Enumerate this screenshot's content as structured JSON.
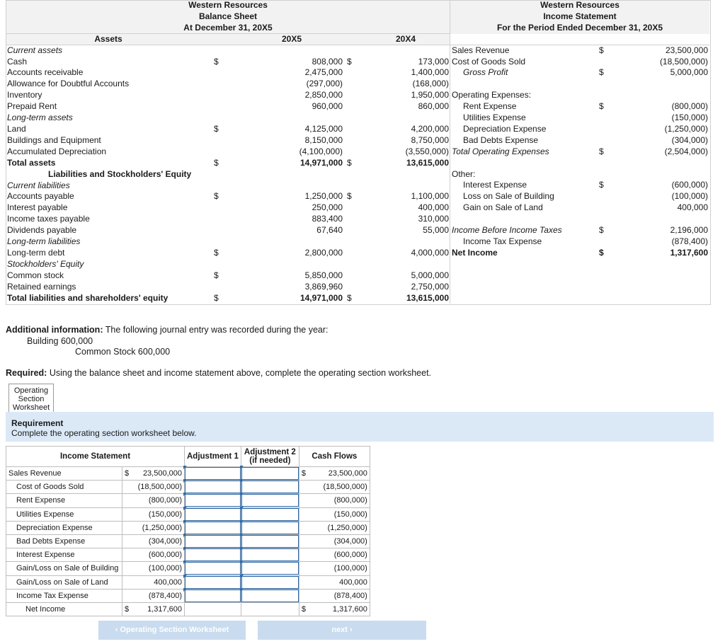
{
  "balance_sheet": {
    "company": "Western Resources",
    "title": "Balance Sheet",
    "date": "At December 31, 20X5",
    "col_assets": "Assets",
    "col_y1": "20X5",
    "col_y2": "20X4",
    "rows": [
      {
        "label": "Current assets",
        "style": "it",
        "d1": "",
        "v1": "",
        "d2": "",
        "v2": ""
      },
      {
        "label": "Cash",
        "style": "",
        "d1": "$",
        "v1": "808,000",
        "d2": "$",
        "v2": "173,000"
      },
      {
        "label": "Accounts receivable",
        "style": "",
        "d1": "",
        "v1": "2,475,000",
        "d2": "",
        "v2": "1,400,000"
      },
      {
        "label": "Allowance for Doubtful Accounts",
        "style": "",
        "d1": "",
        "v1": "(297,000)",
        "d2": "",
        "v2": "(168,000)"
      },
      {
        "label": "Inventory",
        "style": "",
        "d1": "",
        "v1": "2,850,000",
        "d2": "",
        "v2": "1,950,000"
      },
      {
        "label": "Prepaid Rent",
        "style": "",
        "d1": "",
        "v1": "960,000",
        "d2": "",
        "v2": "860,000"
      },
      {
        "label": "Long-term assets",
        "style": "it",
        "d1": "",
        "v1": "",
        "d2": "",
        "v2": ""
      },
      {
        "label": "Land",
        "style": "",
        "d1": "$",
        "v1": "4,125,000",
        "d2": "",
        "v2": "4,200,000"
      },
      {
        "label": "Buildings and Equipment",
        "style": "",
        "d1": "",
        "v1": "8,150,000",
        "d2": "",
        "v2": "8,750,000"
      },
      {
        "label": "Accumulated Depreciation",
        "style": "",
        "d1": "",
        "v1": "(4,100,000)",
        "d2": "",
        "v2": "(3,550,000)"
      },
      {
        "label": "Total assets",
        "style": "b",
        "d1": "$",
        "v1": "14,971,000",
        "d2": "$",
        "v2": "13,615,000"
      },
      {
        "label": "Liabilities and Stockholders' Equity",
        "style": "bc",
        "d1": "",
        "v1": "",
        "d2": "",
        "v2": ""
      },
      {
        "label": "Current liabilities",
        "style": "it",
        "d1": "",
        "v1": "",
        "d2": "",
        "v2": ""
      },
      {
        "label": "Accounts payable",
        "style": "",
        "d1": "$",
        "v1": "1,250,000",
        "d2": "$",
        "v2": "1,100,000"
      },
      {
        "label": "Interest payable",
        "style": "",
        "d1": "",
        "v1": "250,000",
        "d2": "",
        "v2": "400,000"
      },
      {
        "label": "Income taxes payable",
        "style": "",
        "d1": "",
        "v1": "883,400",
        "d2": "",
        "v2": "310,000"
      },
      {
        "label": "Dividends payable",
        "style": "",
        "d1": "",
        "v1": "67,640",
        "d2": "",
        "v2": "55,000"
      },
      {
        "label": "Long-term liabilities",
        "style": "it",
        "d1": "",
        "v1": "",
        "d2": "",
        "v2": ""
      },
      {
        "label": "Long-term debt",
        "style": "",
        "d1": "$",
        "v1": "2,800,000",
        "d2": "",
        "v2": "4,000,000"
      },
      {
        "label": "Stockholders' Equity",
        "style": "it",
        "d1": "",
        "v1": "",
        "d2": "",
        "v2": ""
      },
      {
        "label": "Common stock",
        "style": "",
        "d1": "$",
        "v1": "5,850,000",
        "d2": "",
        "v2": "5,000,000"
      },
      {
        "label": "Retained earnings",
        "style": "",
        "d1": "",
        "v1": "3,869,960",
        "d2": "",
        "v2": "2,750,000"
      },
      {
        "label": "Total liabilities and shareholders' equity",
        "style": "b",
        "d1": "$",
        "v1": "14,971,000",
        "d2": "$",
        "v2": "13,615,000"
      }
    ]
  },
  "income_statement": {
    "company": "Western Resources",
    "title": "Income Statement",
    "period": "For the Period Ended December 31, 20X5",
    "rows": [
      {
        "label": "Sales Revenue",
        "style": "",
        "d": "$",
        "v": "23,500,000"
      },
      {
        "label": "Cost of Goods Sold",
        "style": "",
        "d": "",
        "v": "(18,500,000)"
      },
      {
        "label": "Gross Profit",
        "style": "it ind1",
        "d": "$",
        "v": "5,000,000"
      },
      {
        "label": "",
        "style": "",
        "d": "",
        "v": ""
      },
      {
        "label": "Operating Expenses:",
        "style": "",
        "d": "",
        "v": ""
      },
      {
        "label": "Rent Expense",
        "style": "ind1",
        "d": "$",
        "v": "(800,000)"
      },
      {
        "label": "Utilities Expense",
        "style": "ind1",
        "d": "",
        "v": "(150,000)"
      },
      {
        "label": "Depreciation Expense",
        "style": "ind1",
        "d": "",
        "v": "(1,250,000)"
      },
      {
        "label": "Bad Debts Expense",
        "style": "ind1",
        "d": "",
        "v": "(304,000)"
      },
      {
        "label": "Total Operating Expenses",
        "style": "it",
        "d": "$",
        "v": "(2,504,000)"
      },
      {
        "label": "",
        "style": "",
        "d": "",
        "v": ""
      },
      {
        "label": "Other:",
        "style": "",
        "d": "",
        "v": ""
      },
      {
        "label": "Interest Expense",
        "style": "ind1",
        "d": "$",
        "v": "(600,000)"
      },
      {
        "label": "Loss on Sale of Building",
        "style": "ind1",
        "d": "",
        "v": "(100,000)"
      },
      {
        "label": "Gain on Sale of Land",
        "style": "ind1",
        "d": "",
        "v": "400,000"
      },
      {
        "label": "",
        "style": "",
        "d": "",
        "v": ""
      },
      {
        "label": "Income Before Income Taxes",
        "style": "it",
        "d": "$",
        "v": "2,196,000"
      },
      {
        "label": "Income Tax Expense",
        "style": "ind1",
        "d": "",
        "v": "(878,400)"
      },
      {
        "label": "Net Income",
        "style": "b",
        "d": "$",
        "v": "1,317,600"
      }
    ]
  },
  "additional": {
    "label": "Additional information:",
    "text": " The following journal entry was recorded during the year:",
    "entry1": "Building  600,000",
    "entry2": "Common Stock 600,000"
  },
  "required": {
    "label": "Required:",
    "text": " Using the balance sheet and income statement above, complete the operating section worksheet."
  },
  "tab": {
    "l1": "Operating",
    "l2": "Section",
    "l3": "Worksheet"
  },
  "requirement": {
    "title": "Requirement",
    "text": "Complete the operating section worksheet below."
  },
  "worksheet": {
    "headers": {
      "is": "Income Statement",
      "adj1": "Adjustment 1",
      "adj2a": "Adjustment 2",
      "adj2b": "(if needed)",
      "cf": "Cash Flows"
    },
    "rows": [
      {
        "label": "Sales Revenue",
        "d": "$",
        "v": "23,500,000",
        "cd": "$",
        "c": "23,500,000",
        "indent": false
      },
      {
        "label": "Cost of Goods Sold",
        "d": "",
        "v": "(18,500,000)",
        "cd": "",
        "c": "(18,500,000)",
        "indent": true
      },
      {
        "label": "Rent Expense",
        "d": "",
        "v": "(800,000)",
        "cd": "",
        "c": "(800,000)",
        "indent": true
      },
      {
        "label": "Utilities Expense",
        "d": "",
        "v": "(150,000)",
        "cd": "",
        "c": "(150,000)",
        "indent": true
      },
      {
        "label": "Depreciation Expense",
        "d": "",
        "v": "(1,250,000)",
        "cd": "",
        "c": "(1,250,000)",
        "indent": true
      },
      {
        "label": "Bad Debts Expense",
        "d": "",
        "v": "(304,000)",
        "cd": "",
        "c": "(304,000)",
        "indent": true
      },
      {
        "label": "Interest Expense",
        "d": "",
        "v": "(600,000)",
        "cd": "",
        "c": "(600,000)",
        "indent": true
      },
      {
        "label": "Gain/Loss on Sale of Building",
        "d": "",
        "v": "(100,000)",
        "cd": "",
        "c": "(100,000)",
        "indent": true
      },
      {
        "label": "Gain/Loss on Sale of Land",
        "d": "",
        "v": "400,000",
        "cd": "",
        "c": "400,000",
        "indent": true
      },
      {
        "label": "Income Tax Expense",
        "d": "",
        "v": "(878,400)",
        "cd": "",
        "c": "(878,400)",
        "indent": true
      },
      {
        "label": "Net Income",
        "d": "$",
        "v": "1,317,600",
        "cd": "$",
        "c": "1,317,600",
        "indent": "net"
      }
    ]
  },
  "nav": {
    "prev": "‹  Operating Section Worksheet",
    "next": "next  ›"
  }
}
